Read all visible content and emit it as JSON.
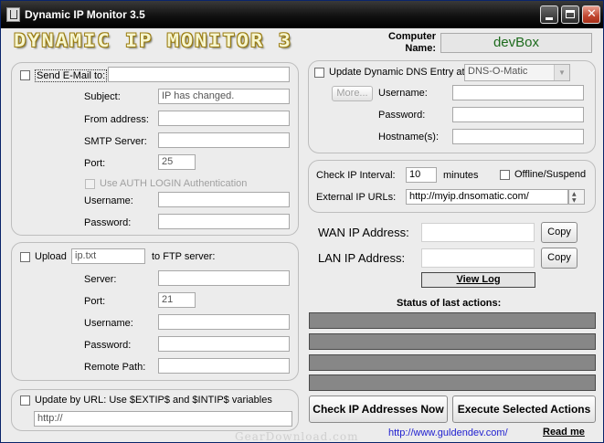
{
  "window": {
    "title": "Dynamic IP Monitor 3.5"
  },
  "logo": {
    "text": "DYNAMIC IP MONITOR 3"
  },
  "computer": {
    "label": "Computer Name:",
    "value": "devBox"
  },
  "email": {
    "send_label": "Send E-Mail to:",
    "to_value": "",
    "subject_label": "Subject:",
    "subject_value": "IP has changed.",
    "from_label": "From address:",
    "from_value": "",
    "smtp_label": "SMTP Server:",
    "smtp_value": "",
    "port_label": "Port:",
    "port_value": "25",
    "auth_label": "Use AUTH LOGIN Authentication",
    "username_label": "Username:",
    "username_value": "",
    "password_label": "Password:",
    "password_value": ""
  },
  "ftp": {
    "upload_label": "Upload",
    "file_value": "ip.txt",
    "to_label": "to FTP server:",
    "server_label": "Server:",
    "server_value": "",
    "port_label": "Port:",
    "port_value": "21",
    "username_label": "Username:",
    "username_value": "",
    "password_label": "Password:",
    "password_value": "",
    "remote_label": "Remote Path:",
    "remote_value": ""
  },
  "url_update": {
    "label": "Update by URL: Use $EXTIP$ and $INTIP$ variables",
    "value": "http://"
  },
  "dns": {
    "label": "Update Dynamic DNS Entry at",
    "provider": "DNS-O-Matic",
    "more_label": "More...",
    "username_label": "Username:",
    "username_value": "",
    "password_label": "Password:",
    "password_value": "",
    "hostname_label": "Hostname(s):",
    "hostname_value": ""
  },
  "check": {
    "interval_label": "Check IP Interval:",
    "interval_value": "10",
    "minutes_label": "minutes",
    "offline_label": "Offline/Suspend",
    "urls_label": "External IP URLs:",
    "urls_value": "http://myip.dnsomatic.com/"
  },
  "ip": {
    "wan_label": "WAN IP Address:",
    "wan_value": "",
    "lan_label": "LAN IP Address:",
    "lan_value": "",
    "copy_label": "Copy",
    "view_log_label": "View Log"
  },
  "status": {
    "title": "Status of last actions:",
    "lines": [
      "",
      "",
      "",
      ""
    ]
  },
  "actions": {
    "check_now": "Check IP Addresses Now",
    "execute": "Execute Selected Actions"
  },
  "footer": {
    "url": "http://www.guldendev.com/",
    "readme": "Read me"
  },
  "watermark": "GearDownload.com",
  "colors": {
    "status_bar": "#878787",
    "link": "#2020d0",
    "computer_name": "#1d6b1d"
  }
}
